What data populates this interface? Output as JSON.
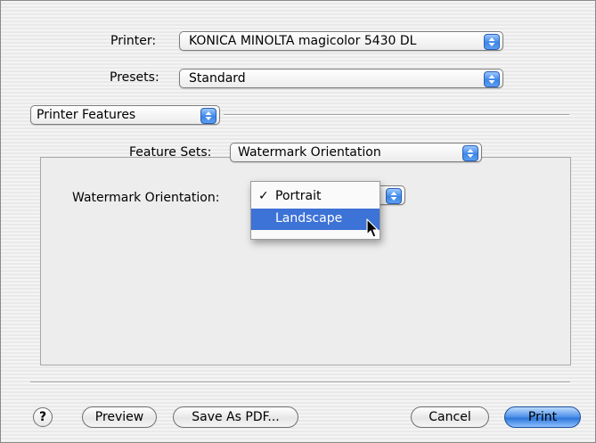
{
  "printer": {
    "label": "Printer:",
    "value": "KONICA MINOLTA magicolor 5430 DL"
  },
  "presets": {
    "label": "Presets:",
    "value": "Standard"
  },
  "panel_selector": {
    "value": "Printer Features"
  },
  "feature_sets": {
    "label": "Feature Sets:",
    "value": "Watermark Orientation"
  },
  "watermark_orientation": {
    "label": "Watermark Orientation:",
    "options": [
      {
        "check": "✓",
        "label": "Portrait",
        "selected": true
      },
      {
        "check": "",
        "label": "Landscape",
        "highlighted": true
      }
    ]
  },
  "footer": {
    "help": "?",
    "preview": "Preview",
    "save_pdf": "Save As PDF...",
    "cancel": "Cancel",
    "print": "Print"
  },
  "icons": {
    "popup_arrows": "updown-arrows-icon",
    "cursor": "mouse-pointer-icon",
    "help": "question-icon"
  },
  "colors": {
    "accent": "#3d72d6",
    "default_button": "#4b8ee8"
  }
}
